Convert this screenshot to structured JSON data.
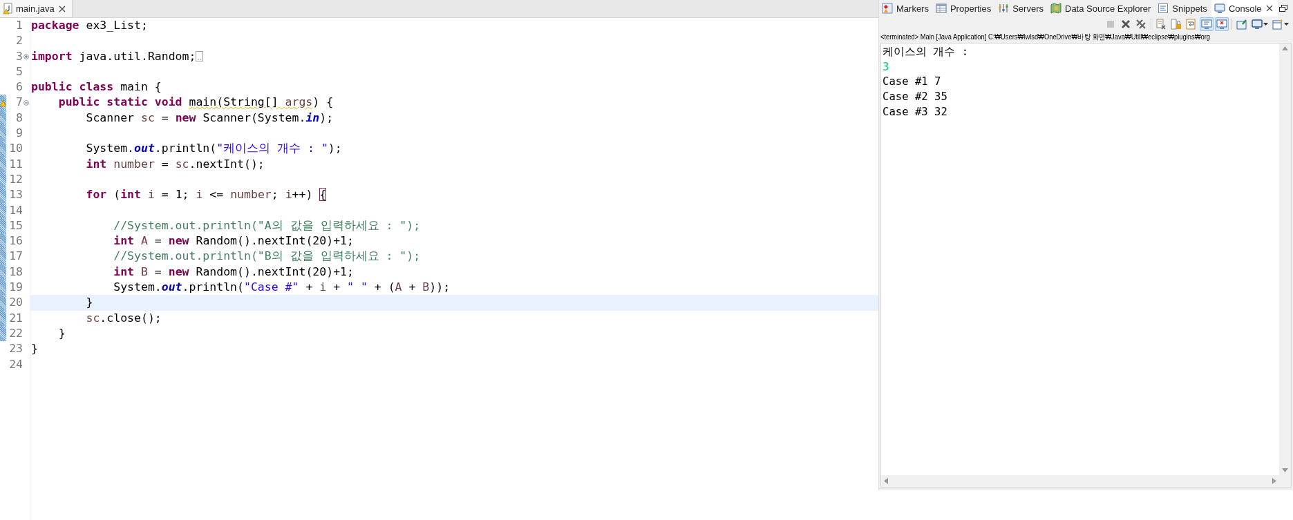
{
  "editor": {
    "tab": {
      "title": "main.java",
      "selected": true,
      "warning": true
    },
    "lines": [
      {
        "number": "1",
        "in_scope": false,
        "highlighted": false,
        "tokens": [
          {
            "kind": "keyword",
            "text": "package"
          },
          {
            "kind": "plain",
            "text": " ex3_List;"
          }
        ]
      },
      {
        "number": "2",
        "in_scope": false,
        "highlighted": false
      },
      {
        "number": "3",
        "collapsed": true,
        "in_scope": false,
        "highlighted": false,
        "tokens": [
          {
            "kind": "keyword",
            "text": "import"
          },
          {
            "kind": "plain",
            "text": " java.util.Random;"
          }
        ]
      },
      {
        "number": "5",
        "in_scope": false,
        "highlighted": false
      },
      {
        "number": "6",
        "in_scope": false,
        "highlighted": false,
        "tokens": [
          {
            "kind": "keyword",
            "text": "public class"
          },
          {
            "kind": "plain",
            "text": " main {"
          }
        ]
      },
      {
        "number": "7",
        "collapsed": false,
        "in_scope": true,
        "highlighted": false,
        "warning": true,
        "tokens": [
          {
            "kind": "keyword",
            "text": "    public static void "
          },
          {
            "kind": "squiggle",
            "text": "main(String[] "
          },
          {
            "kind": "var-squiggle",
            "text": "args"
          },
          {
            "kind": "plain",
            "text": ") {"
          }
        ]
      },
      {
        "number": "8",
        "in_scope": true,
        "highlighted": false,
        "tokens": [
          {
            "kind": "plain",
            "text": "        Scanner "
          },
          {
            "kind": "var",
            "text": "sc"
          },
          {
            "kind": "plain",
            "text": " = "
          },
          {
            "kind": "keyword",
            "text": "new"
          },
          {
            "kind": "plain",
            "text": " Scanner(System."
          },
          {
            "kind": "field",
            "text": "in"
          },
          {
            "kind": "plain",
            "text": ");"
          }
        ]
      },
      {
        "number": "9",
        "in_scope": true,
        "highlighted": false
      },
      {
        "number": "10",
        "in_scope": true,
        "highlighted": false,
        "tokens": [
          {
            "kind": "plain",
            "text": "        System."
          },
          {
            "kind": "field",
            "text": "out"
          },
          {
            "kind": "plain",
            "text": ".println("
          },
          {
            "kind": "string",
            "text": "\"케이스의 개수 : \""
          },
          {
            "kind": "plain",
            "text": ");"
          }
        ]
      },
      {
        "number": "11",
        "in_scope": true,
        "highlighted": false,
        "tokens": [
          {
            "kind": "keyword",
            "text": "        int"
          },
          {
            "kind": "var",
            "text": " number"
          },
          {
            "kind": "plain",
            "text": " = "
          },
          {
            "kind": "var",
            "text": "sc"
          },
          {
            "kind": "plain",
            "text": ".nextInt();"
          }
        ]
      },
      {
        "number": "12",
        "in_scope": true,
        "highlighted": false
      },
      {
        "number": "13",
        "in_scope": true,
        "highlighted": false,
        "tokens": [
          {
            "kind": "keyword",
            "text": "        for"
          },
          {
            "kind": "plain",
            "text": " ("
          },
          {
            "kind": "keyword",
            "text": "int"
          },
          {
            "kind": "var",
            "text": " i"
          },
          {
            "kind": "plain",
            "text": " = 1; "
          },
          {
            "kind": "var",
            "text": "i"
          },
          {
            "kind": "plain",
            "text": " <= "
          },
          {
            "kind": "var",
            "text": "number"
          },
          {
            "kind": "plain",
            "text": "; "
          },
          {
            "kind": "var",
            "text": "i"
          },
          {
            "kind": "plain",
            "text": "++) "
          },
          {
            "kind": "bracket-match",
            "text": "{"
          }
        ]
      },
      {
        "number": "14",
        "in_scope": true,
        "highlighted": false
      },
      {
        "number": "15",
        "in_scope": true,
        "highlighted": false,
        "tokens": [
          {
            "kind": "comment",
            "text": "            //System.out.println(\"A의 값을 입력하세요 : \");"
          }
        ]
      },
      {
        "number": "16",
        "in_scope": true,
        "highlighted": false,
        "tokens": [
          {
            "kind": "keyword",
            "text": "            int"
          },
          {
            "kind": "var",
            "text": " A"
          },
          {
            "kind": "plain",
            "text": " = "
          },
          {
            "kind": "keyword",
            "text": "new"
          },
          {
            "kind": "plain",
            "text": " Random().nextInt(20)+1;"
          }
        ]
      },
      {
        "number": "17",
        "in_scope": true,
        "highlighted": false,
        "tokens": [
          {
            "kind": "comment",
            "text": "            //System.out.println(\"B의 값을 입력하세요 : \");"
          }
        ]
      },
      {
        "number": "18",
        "in_scope": true,
        "highlighted": false,
        "tokens": [
          {
            "kind": "keyword",
            "text": "            int"
          },
          {
            "kind": "var",
            "text": " B"
          },
          {
            "kind": "plain",
            "text": " = "
          },
          {
            "kind": "keyword",
            "text": "new"
          },
          {
            "kind": "plain",
            "text": " Random().nextInt(20)+1;"
          }
        ]
      },
      {
        "number": "19",
        "in_scope": true,
        "highlighted": false,
        "tokens": [
          {
            "kind": "plain",
            "text": "            System."
          },
          {
            "kind": "field",
            "text": "out"
          },
          {
            "kind": "plain",
            "text": ".println("
          },
          {
            "kind": "string",
            "text": "\"Case #\""
          },
          {
            "kind": "plain",
            "text": " + "
          },
          {
            "kind": "var",
            "text": "i"
          },
          {
            "kind": "plain",
            "text": " + "
          },
          {
            "kind": "string",
            "text": "\" \""
          },
          {
            "kind": "plain",
            "text": " + ("
          },
          {
            "kind": "var",
            "text": "A"
          },
          {
            "kind": "plain",
            "text": " + "
          },
          {
            "kind": "var",
            "text": "B"
          },
          {
            "kind": "plain",
            "text": "));"
          }
        ]
      },
      {
        "number": "20",
        "in_scope": true,
        "highlighted": true,
        "tokens": [
          {
            "kind": "plain",
            "text": "        }"
          }
        ]
      },
      {
        "number": "21",
        "in_scope": true,
        "highlighted": false,
        "tokens": [
          {
            "kind": "var",
            "text": "        sc"
          },
          {
            "kind": "plain",
            "text": ".close();"
          }
        ]
      },
      {
        "number": "22",
        "in_scope": true,
        "highlighted": false,
        "tokens": [
          {
            "kind": "plain",
            "text": "    }"
          }
        ]
      },
      {
        "number": "23",
        "in_scope": false,
        "highlighted": false,
        "tokens": [
          {
            "kind": "plain",
            "text": "}"
          }
        ]
      },
      {
        "number": "24",
        "in_scope": false,
        "highlighted": false
      }
    ]
  },
  "views": {
    "tabs": [
      {
        "kind": "markers",
        "label": "Markers",
        "selected": false
      },
      {
        "kind": "properties",
        "label": "Properties",
        "selected": false
      },
      {
        "kind": "servers",
        "label": "Servers",
        "selected": false
      },
      {
        "kind": "datasource",
        "label": "Data Source Explorer",
        "selected": false
      },
      {
        "kind": "snippets",
        "label": "Snippets",
        "selected": false
      },
      {
        "kind": "console",
        "label": "Console",
        "selected": true
      }
    ],
    "toolbar": [
      [
        {
          "kind": "terminate",
          "disabled": true,
          "pressed": false,
          "menu": false
        },
        {
          "kind": "remove",
          "disabled": false,
          "pressed": false,
          "menu": false
        },
        {
          "kind": "remove-all",
          "disabled": false,
          "pressed": false,
          "menu": false
        }
      ],
      [
        {
          "kind": "clear",
          "disabled": false,
          "pressed": false,
          "menu": false
        },
        {
          "kind": "scroll-lock",
          "disabled": false,
          "pressed": false,
          "menu": false
        },
        {
          "kind": "word-wrap",
          "disabled": false,
          "pressed": false,
          "menu": false
        },
        {
          "kind": "show-out",
          "disabled": false,
          "pressed": true,
          "menu": false
        },
        {
          "kind": "show-err",
          "disabled": false,
          "pressed": true,
          "menu": false
        }
      ],
      [
        {
          "kind": "pin",
          "disabled": false,
          "pressed": false,
          "menu": false
        },
        {
          "kind": "display",
          "disabled": false,
          "pressed": false,
          "menu": true
        },
        {
          "kind": "open",
          "disabled": false,
          "pressed": false,
          "menu": true
        }
      ]
    ],
    "header": "<terminated> Main [Java Application] C:₩Users₩lwlsd₩OneDrive₩바탕 화면₩Java₩Utill₩eclipse₩plugins₩org",
    "output": [
      {
        "kind": "stdout",
        "text": "케이스의 개수 : "
      },
      {
        "kind": "stdin",
        "text": "3"
      },
      {
        "kind": "stdout",
        "text": "Case #1 7"
      },
      {
        "kind": "stdout",
        "text": "Case #2 35"
      },
      {
        "kind": "stdout",
        "text": "Case #3 32"
      }
    ]
  }
}
